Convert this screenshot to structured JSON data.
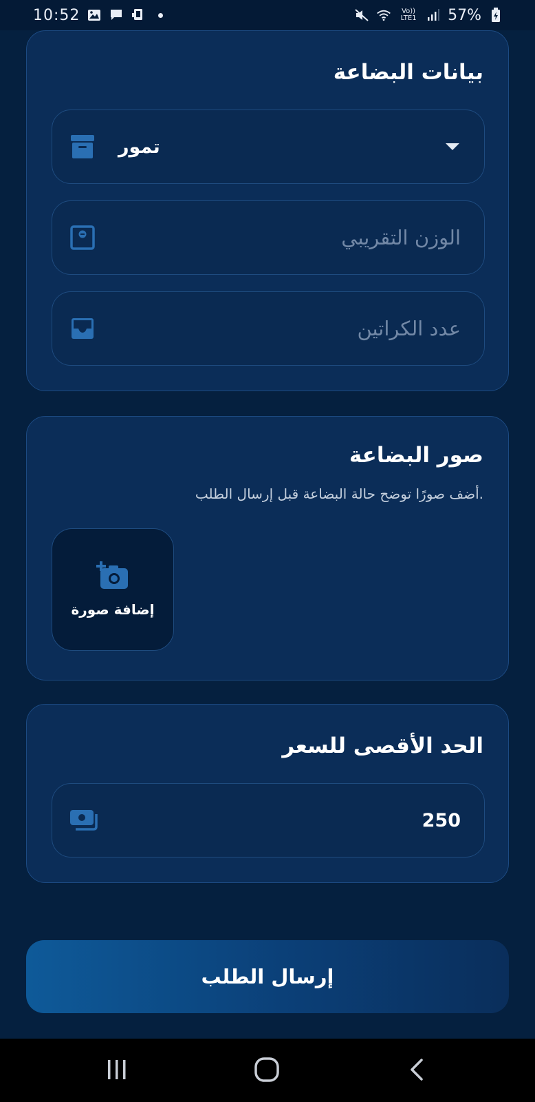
{
  "status_bar": {
    "time": "10:52",
    "battery": "57%",
    "network": "Vo)) LTE1"
  },
  "goods_card": {
    "title": "بيانات البضاعة",
    "type_select": {
      "value": "تمور",
      "icon": "archive-box-icon"
    },
    "weight_field": {
      "placeholder": "الوزن التقريبي",
      "value": "",
      "icon": "scale-icon"
    },
    "cartons_field": {
      "placeholder": "عدد الكراتين",
      "value": "",
      "icon": "inbox-tray-icon"
    }
  },
  "photos_card": {
    "title": "صور البضاعة",
    "subtitle": ".أضف صورًا توضح حالة البضاعة قبل إرسال الطلب",
    "add_photo_label": "إضافة صورة",
    "add_photo_icon": "add-camera-icon"
  },
  "price_card": {
    "title": "الحد الأقصى للسعر",
    "price_field": {
      "value": "250",
      "icon": "money-icon"
    }
  },
  "submit": {
    "label": "إرسال الطلب"
  },
  "colors": {
    "background": "#05203f",
    "card": "#0b2d58",
    "accent_icon": "#2a6fb3",
    "button_start": "#0e5a99"
  }
}
